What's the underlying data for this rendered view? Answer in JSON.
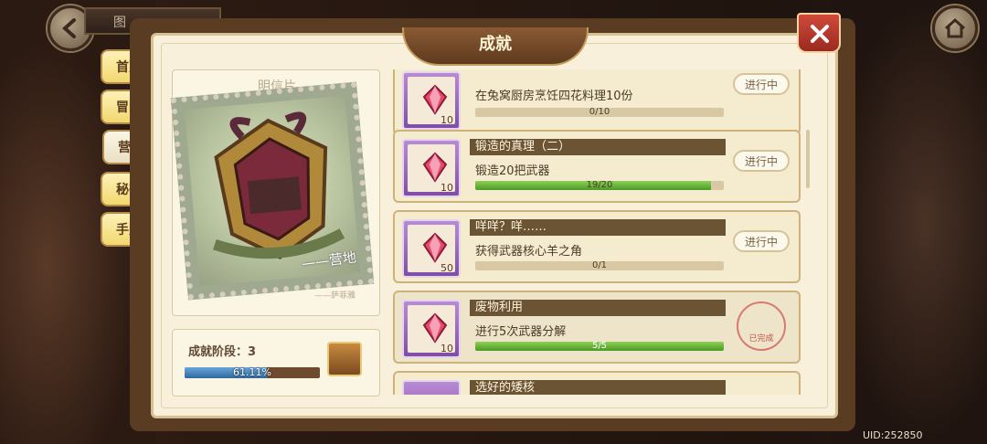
{
  "nav": {
    "top_label": "图",
    "tabs": [
      {
        "label": "首页"
      },
      {
        "label": "冒险"
      },
      {
        "label": "营地",
        "active": true
      },
      {
        "label": "秘密"
      },
      {
        "label": "手账"
      }
    ]
  },
  "panel": {
    "title": "成就",
    "postcard_label": "明信片",
    "stamp_caption": "——营地",
    "signature": "——萨菲雅",
    "stage_text": "成就阶段：3",
    "stage_progress": 0.6111,
    "stage_pct_text": "61.11%"
  },
  "achievements": [
    {
      "title": "",
      "desc": "在兔窝厨房烹饪四花料理10份",
      "progress_text": "0/10",
      "progress": 0.0,
      "reward": "10",
      "status": "进行中"
    },
    {
      "title": "锻造的真理（二）",
      "desc": "锻造20把武器",
      "progress_text": "19/20",
      "progress": 0.95,
      "reward": "10",
      "status": "进行中"
    },
    {
      "title": "咩咩？咩……",
      "desc": "获得武器核心羊之角",
      "progress_text": "0/1",
      "progress": 0.0,
      "reward": "50",
      "status": "进行中"
    },
    {
      "title": "废物利用",
      "desc": "进行5次武器分解",
      "progress_text": "5/5",
      "progress": 1.0,
      "reward": "10",
      "status": "已完成"
    },
    {
      "title": "选好的矮核",
      "desc": "",
      "progress_text": "",
      "progress": 0.0,
      "reward": "",
      "status": ""
    }
  ],
  "uid": "UID:252850",
  "colors": {
    "accent_gold": "#f2d870",
    "progress_green": "#4a9a24",
    "gem_purple": "#7e4ea6"
  }
}
